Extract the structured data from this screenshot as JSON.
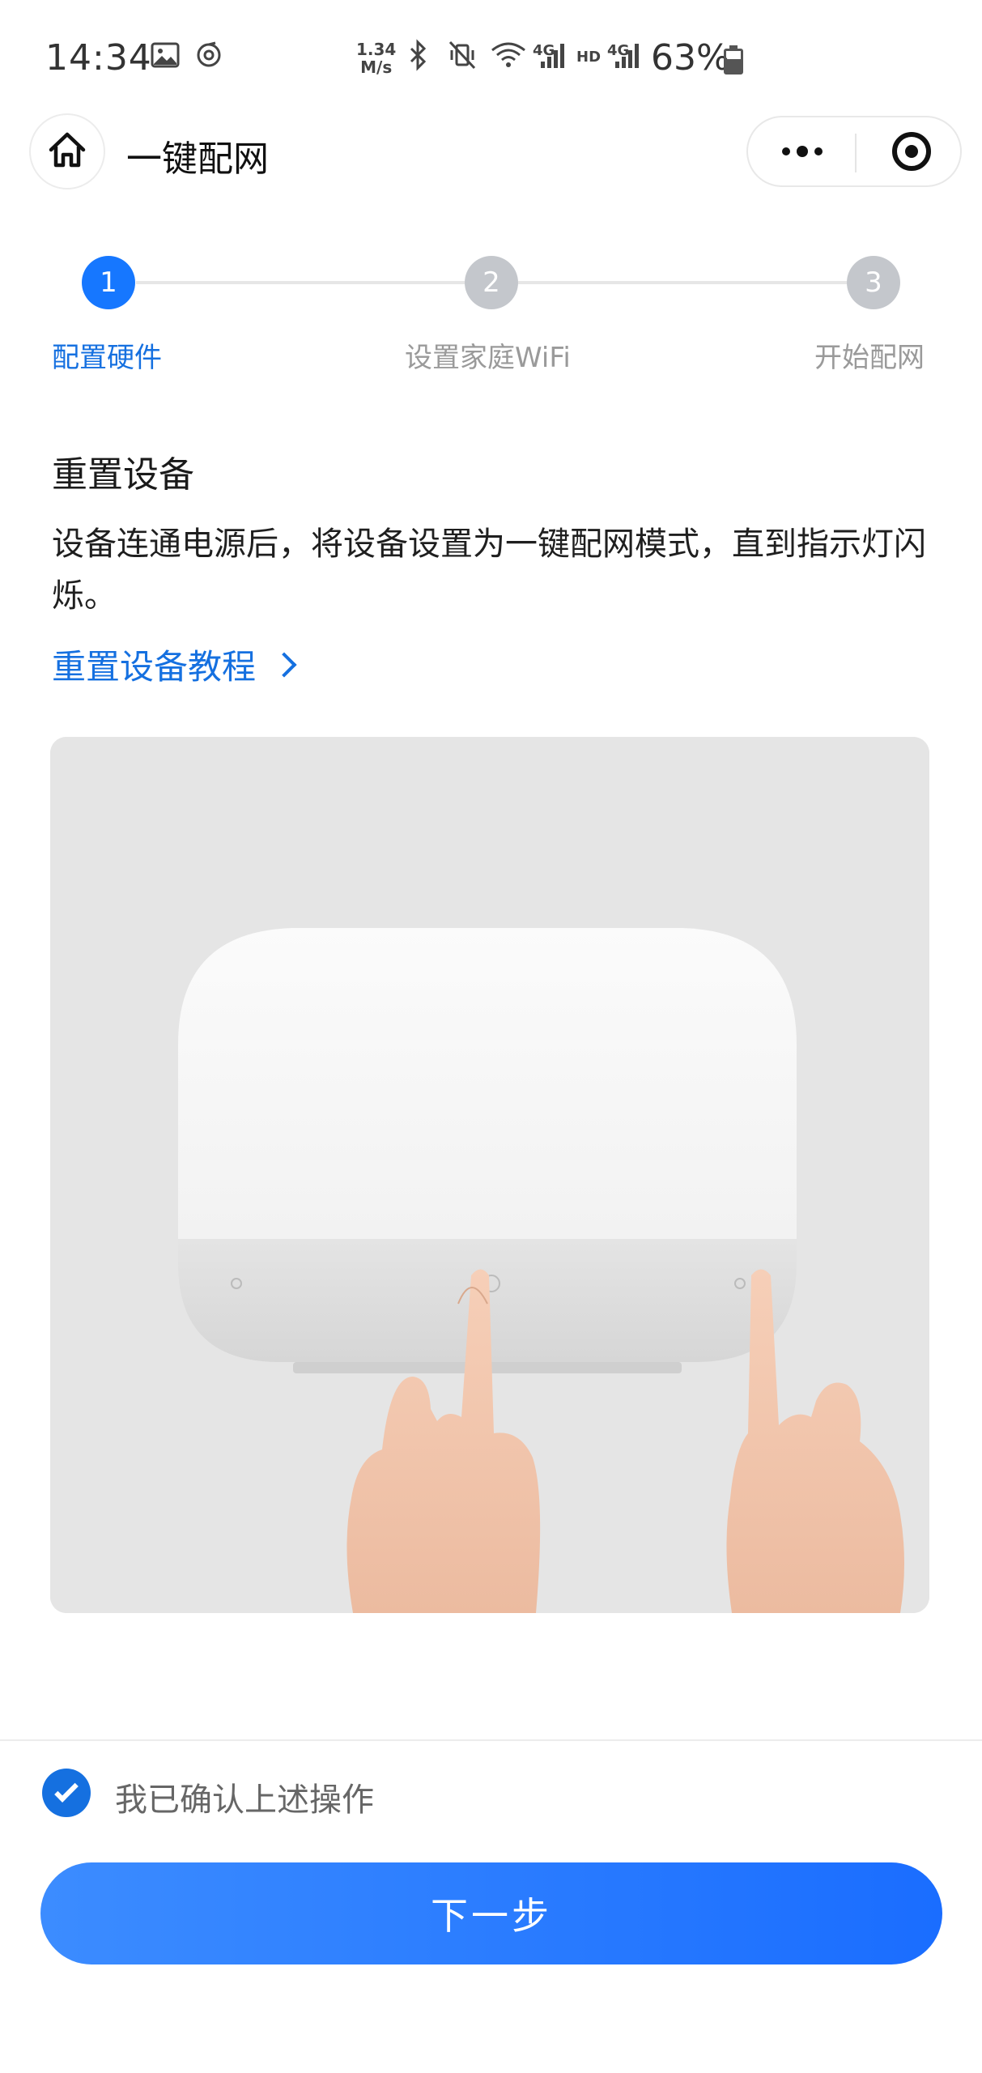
{
  "status_bar": {
    "time": "14:34",
    "speed_value": "1.34",
    "speed_unit": "M/s",
    "net1": "4G",
    "hd": "HD",
    "net2": "4G",
    "battery": "63%",
    "battery_level": 0.63,
    "icons": [
      "gallery-icon",
      "sync-icon",
      "bluetooth-icon",
      "vibrate-mute-icon",
      "wifi-icon",
      "signal-icon",
      "signal-icon",
      "battery-icon"
    ]
  },
  "header": {
    "title": "一键配网",
    "home_icon": "home-icon",
    "more_icon": "more-icon",
    "target_icon": "target-icon"
  },
  "steps": [
    {
      "number": "1",
      "label": "配置硬件",
      "state": "active"
    },
    {
      "number": "2",
      "label": "设置家庭WiFi",
      "state": "todo"
    },
    {
      "number": "3",
      "label": "开始配网",
      "state": "todo"
    }
  ],
  "content": {
    "title": "重置设备",
    "description": "设备连通电源后，将设备设置为一键配网模式，直到指示灯闪烁。",
    "tutorial_link": "重置设备教程"
  },
  "footer": {
    "confirm_label": "我已确认上述操作",
    "confirm_checked": true,
    "next_button": "下一步"
  },
  "colors": {
    "accent": "#1677ff",
    "link": "#1570e0",
    "inactive_step": "#c4c7cc"
  }
}
